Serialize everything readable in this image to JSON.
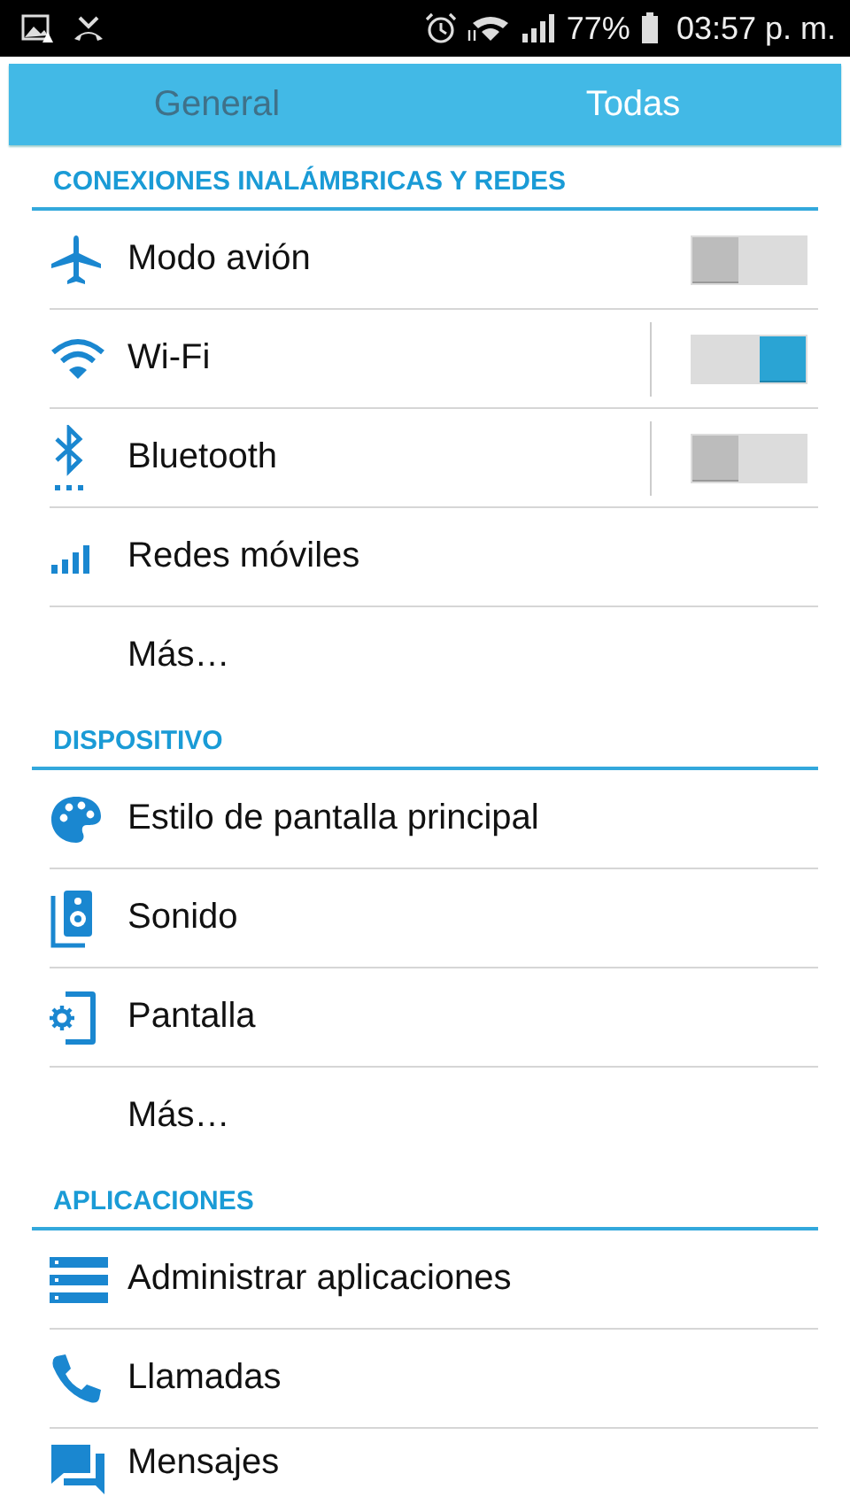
{
  "status_bar": {
    "battery": "77%",
    "time": "03:57 p. m."
  },
  "tabs": [
    {
      "label": "General",
      "selected": false
    },
    {
      "label": "Todas",
      "selected": true
    }
  ],
  "sections": [
    {
      "title": "CONEXIONES INALÁMBRICAS Y REDES",
      "items": [
        {
          "label": "Modo avión",
          "kind": "switch",
          "on": false,
          "split": false
        },
        {
          "label": "Wi-Fi",
          "kind": "switch",
          "on": true,
          "split": true
        },
        {
          "label": "Bluetooth",
          "kind": "switch",
          "on": false,
          "split": true
        },
        {
          "label": "Redes móviles",
          "kind": "plain"
        },
        {
          "label": "Más…",
          "kind": "plain"
        }
      ]
    },
    {
      "title": "DISPOSITIVO",
      "items": [
        {
          "label": "Estilo de pantalla principal",
          "kind": "plain"
        },
        {
          "label": "Sonido",
          "kind": "plain"
        },
        {
          "label": "Pantalla",
          "kind": "plain"
        },
        {
          "label": "Más…",
          "kind": "plain"
        }
      ]
    },
    {
      "title": "APLICACIONES",
      "items": [
        {
          "label": "Administrar aplicaciones",
          "kind": "plain"
        },
        {
          "label": "Llamadas",
          "kind": "plain"
        },
        {
          "label": "Mensajes",
          "kind": "plain"
        }
      ]
    }
  ]
}
